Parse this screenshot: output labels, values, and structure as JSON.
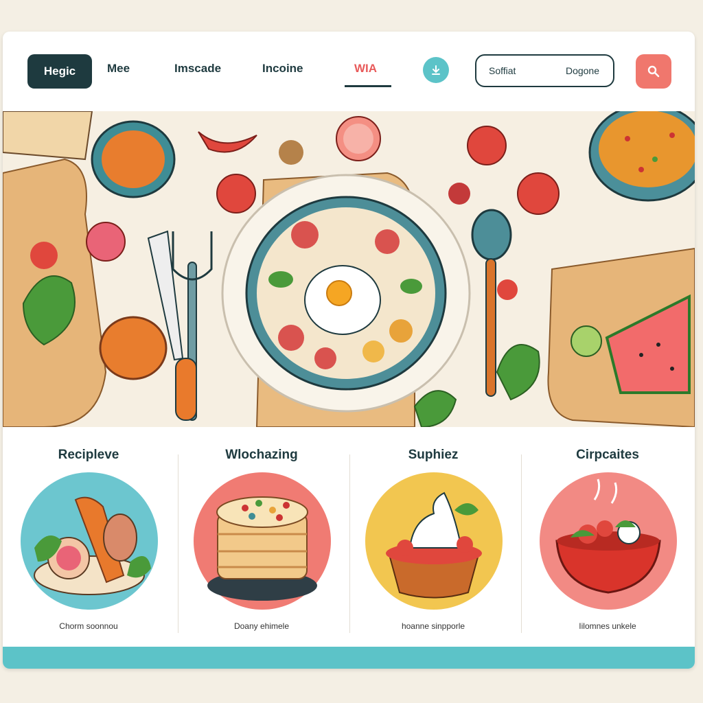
{
  "nav": {
    "brand_label": "Hegic",
    "links": [
      {
        "label": "Mee"
      },
      {
        "label": "Imscade"
      },
      {
        "label": "Incoine"
      },
      {
        "label": "WIA",
        "active": true
      }
    ],
    "icon": "download-icon",
    "search": {
      "value_left": "Soffiat",
      "value_right": "Dogone"
    },
    "search_button_icon": "search-icon"
  },
  "hero": {
    "image": "food-illustration-banner"
  },
  "cards": [
    {
      "title": "Recipleve",
      "caption": "Chorm soonnou",
      "image": "vegetable-platter-illustration",
      "bg": "#6cc6cf"
    },
    {
      "title": "Wlochazing",
      "caption": "Doany ehimele",
      "image": "layered-cake-illustration",
      "bg": "#f07b73"
    },
    {
      "title": "Suphiez",
      "caption": "hoanne sinpporle",
      "image": "cream-dessert-illustration",
      "bg": "#f2c650"
    },
    {
      "title": "Cirpcaites",
      "caption": "Iilomnes unkele",
      "image": "salad-bowl-illustration",
      "bg": "#f28a84"
    }
  ],
  "colors": {
    "dark": "#1e3a3f",
    "accent": "#f0776d",
    "teal": "#5cc3c8"
  }
}
